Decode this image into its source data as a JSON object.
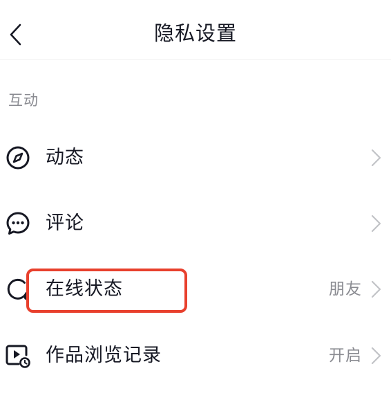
{
  "header": {
    "title": "隐私设置",
    "back_icon": "chevron-left-icon"
  },
  "section": {
    "label": "互动"
  },
  "items": [
    {
      "label": "动态",
      "icon": "compass-icon",
      "value": ""
    },
    {
      "label": "评论",
      "icon": "chat-bubble-icon",
      "value": ""
    },
    {
      "label": "在线状态",
      "icon": "online-status-icon",
      "value": "朋友"
    },
    {
      "label": "作品浏览记录",
      "icon": "play-history-icon",
      "value": "开启"
    }
  ],
  "colors": {
    "highlight": "#e8402d",
    "text_primary": "#161823",
    "text_secondary": "#8a8b91"
  }
}
